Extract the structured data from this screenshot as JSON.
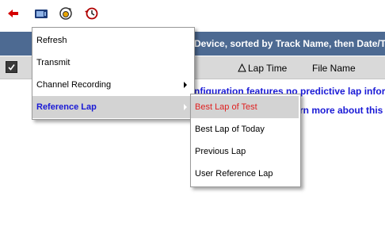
{
  "toolbar": {
    "icons": [
      "back-arrow-icon",
      "device-icon",
      "refresh-gear-icon",
      "history-clock-icon"
    ],
    "colors": {
      "back": "#d40000",
      "device": "#1b3a78",
      "accent": "#e8a400"
    }
  },
  "header": {
    "title": "Device, sorted by Track Name, then Date/Ti"
  },
  "columns": {
    "lap_time": "Lap Time",
    "file_name": "File Name"
  },
  "info": {
    "line1": "nfiguration features no predictive lap infor",
    "line2": "rn more about this f"
  },
  "context_menu": {
    "items": [
      {
        "label": "Refresh"
      },
      {
        "label": "Transmit"
      },
      {
        "label": "Channel Recording",
        "has_submenu": true
      },
      {
        "label": "Reference Lap",
        "has_submenu": true,
        "highlighted": true
      }
    ]
  },
  "submenu": {
    "items": [
      {
        "label": "Best Lap of Test",
        "highlighted": true
      },
      {
        "label": "Best Lap of Today"
      },
      {
        "label": "Previous Lap"
      },
      {
        "label": "User Reference Lap"
      }
    ]
  },
  "colors": {
    "header_bg": "#4d6a92",
    "link_blue": "#1a1ad6",
    "highlight_bg": "#d3d3d3",
    "highlight_red": "#e02020"
  }
}
